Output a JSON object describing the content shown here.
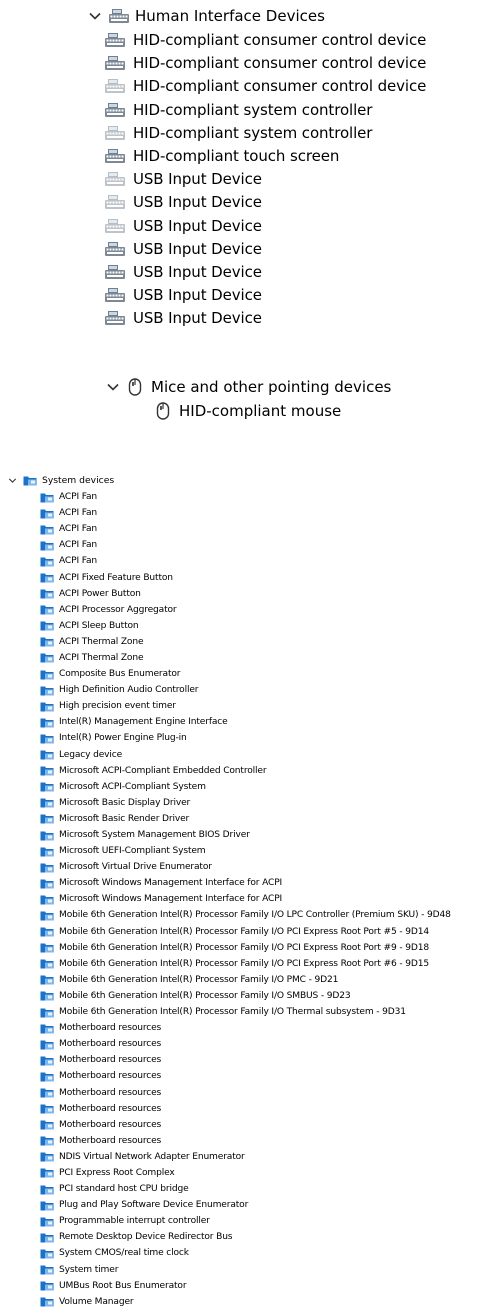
{
  "hid": {
    "header": "Human Interface Devices",
    "items": [
      {
        "label": "HID-compliant consumer control device",
        "faded": false
      },
      {
        "label": "HID-compliant consumer control device",
        "faded": false
      },
      {
        "label": "HID-compliant consumer control device",
        "faded": true
      },
      {
        "label": "HID-compliant system controller",
        "faded": false
      },
      {
        "label": "HID-compliant system controller",
        "faded": true
      },
      {
        "label": "HID-compliant touch screen",
        "faded": false
      },
      {
        "label": "USB Input Device",
        "faded": true
      },
      {
        "label": "USB Input Device",
        "faded": true
      },
      {
        "label": "USB Input Device",
        "faded": true
      },
      {
        "label": "USB Input Device",
        "faded": false
      },
      {
        "label": "USB Input Device",
        "faded": false
      },
      {
        "label": "USB Input Device",
        "faded": false
      },
      {
        "label": "USB Input Device",
        "faded": false
      }
    ]
  },
  "mice": {
    "header": "Mice and other pointing devices",
    "items": [
      {
        "label": "HID-compliant mouse"
      }
    ]
  },
  "system": {
    "header": "System devices",
    "items": [
      "ACPI Fan",
      "ACPI Fan",
      "ACPI Fan",
      "ACPI Fan",
      "ACPI Fan",
      "ACPI Fixed Feature Button",
      "ACPI Power Button",
      "ACPI Processor Aggregator",
      "ACPI Sleep Button",
      "ACPI Thermal Zone",
      "ACPI Thermal Zone",
      "Composite Bus Enumerator",
      "High Definition Audio Controller",
      "High precision event timer",
      "Intel(R) Management Engine Interface",
      "Intel(R) Power Engine Plug-in",
      "Legacy device",
      "Microsoft ACPI-Compliant Embedded Controller",
      "Microsoft ACPI-Compliant System",
      "Microsoft Basic Display Driver",
      "Microsoft Basic Render Driver",
      "Microsoft System Management BIOS Driver",
      "Microsoft UEFI-Compliant System",
      "Microsoft Virtual Drive Enumerator",
      "Microsoft Windows Management Interface for ACPI",
      "Microsoft Windows Management Interface for ACPI",
      "Mobile 6th Generation Intel(R) Processor Family I/O LPC Controller (Premium SKU) - 9D48",
      "Mobile 6th Generation Intel(R) Processor Family I/O PCI Express Root Port #5 - 9D14",
      "Mobile 6th Generation Intel(R) Processor Family I/O PCI Express Root Port #9 - 9D18",
      "Mobile 6th Generation Intel(R) Processor Family I/O PCI Express Root Port #6 - 9D15",
      "Mobile 6th Generation Intel(R) Processor Family I/O PMC - 9D21",
      "Mobile 6th Generation Intel(R) Processor Family I/O SMBUS - 9D23",
      "Mobile 6th Generation Intel(R) Processor Family I/O Thermal subsystem - 9D31",
      "Motherboard resources",
      "Motherboard resources",
      "Motherboard resources",
      "Motherboard resources",
      "Motherboard resources",
      "Motherboard resources",
      "Motherboard resources",
      "Motherboard resources",
      "NDIS Virtual Network Adapter Enumerator",
      "PCI Express Root Complex",
      "PCI standard host CPU bridge",
      "Plug and Play Software Device Enumerator",
      "Programmable interrupt controller",
      "Remote Desktop Device Redirector Bus",
      "System CMOS/real time clock",
      "System timer",
      "UMBus Root Bus Enumerator",
      "Volume Manager"
    ]
  },
  "icons": {
    "hid_category": "keyboard-device-icon",
    "hid_item": "keyboard-device-icon",
    "mice_category": "mouse-icon",
    "mice_item": "mouse-icon",
    "system_category": "system-folder-icon",
    "system_item": "system-folder-icon",
    "expand": "chevron-down-icon"
  },
  "colors": {
    "folder_blue": "#1a73c8",
    "folder_light": "#7fb8e8",
    "chevron": "#333333"
  }
}
